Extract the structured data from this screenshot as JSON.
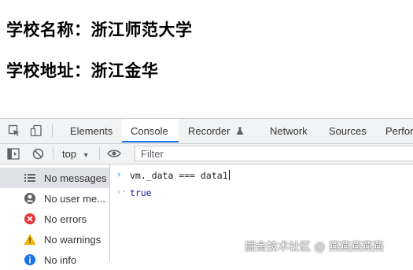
{
  "page": {
    "line1": "学校名称：浙江师范大学",
    "line2": "学校地址：浙江金华"
  },
  "devtools": {
    "tabs": [
      {
        "label": "Elements",
        "active": false
      },
      {
        "label": "Console",
        "active": true
      },
      {
        "label": "Recorder",
        "active": false
      },
      {
        "label": "Network",
        "active": false
      },
      {
        "label": "Sources",
        "active": false
      },
      {
        "label": "Perfor",
        "active": false
      }
    ],
    "toolbar": {
      "context": "top",
      "filter_placeholder": "Filter"
    },
    "sidebar": [
      {
        "label": "No messages",
        "icon": "list-icon",
        "selected": true
      },
      {
        "label": "No user me...",
        "icon": "user-icon",
        "selected": false
      },
      {
        "label": "No errors",
        "icon": "error-icon",
        "selected": false
      },
      {
        "label": "No warnings",
        "icon": "warning-icon",
        "selected": false
      },
      {
        "label": "No info",
        "icon": "info-icon",
        "selected": false
      }
    ],
    "console": [
      {
        "type": "input",
        "prompt": "›",
        "text": "vm._data === data1"
      },
      {
        "type": "output",
        "prompt": "‹·",
        "text": "true"
      }
    ]
  },
  "watermark": "掘金技术社区 @ 燕燕燕燕燕"
}
